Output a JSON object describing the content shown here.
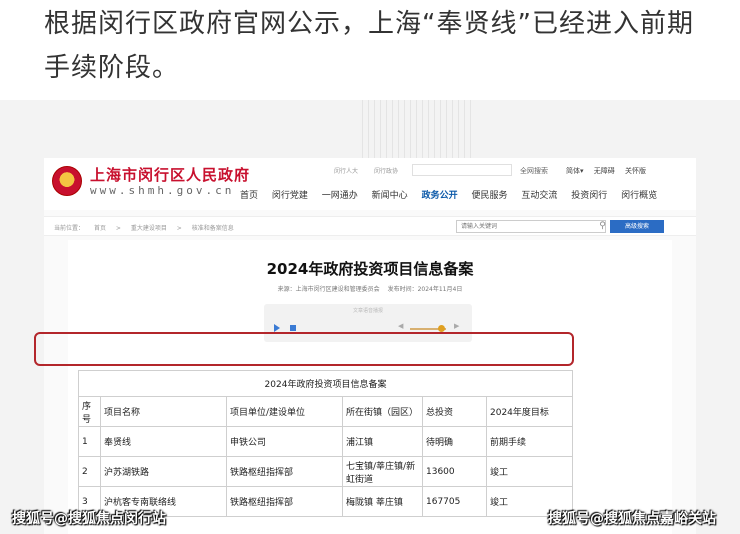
{
  "headline": {
    "line1": "根据闵行区政府官网公示，上海“奉贤线”已经进入前期",
    "line2": "手续阶段。"
  },
  "site": {
    "name": "上海市闵行区人民政府",
    "url": "www.shmh.gov.cn",
    "emblem_icon": "national-emblem-icon",
    "top_links": [
      "闵行人大",
      "闵行政协"
    ],
    "full_search": "全网搜索",
    "lang": [
      "简体▾",
      "无障碍",
      "关怀版"
    ],
    "nav": [
      "首页",
      "闵行党建",
      "一网通办",
      "新闻中心",
      "政务公开",
      "便民服务",
      "互动交流",
      "投资闵行",
      "闵行概览"
    ],
    "nav_active": "政务公开"
  },
  "breadcrumb": {
    "items": [
      "当前位置：",
      "首页",
      ">",
      "重大建设项目",
      ">",
      "核准和备案信息"
    ],
    "search_placeholder": "请输入关键词",
    "search_icon": "search-icon",
    "advanced_label": "高级搜索"
  },
  "document": {
    "title": "2024年政府投资项目信息备案",
    "source": "来源：上海市闵行区建设和管理委员会",
    "published": "发布时间：2024年11月4日",
    "player_label": "文章语音播报"
  },
  "table": {
    "caption": "2024年政府投资项目信息备案",
    "headers": [
      "序号",
      "项目名称",
      "项目单位/建设单位",
      "所在街镇（园区）",
      "总投资",
      "2024年度目标"
    ],
    "rows": [
      [
        "1",
        "奉贤线",
        "申铁公司",
        "浦江镇",
        "待明确",
        "前期手续"
      ],
      [
        "2",
        "沪苏湖铁路",
        "铁路枢纽指挥部",
        "七宝镇/莘庄镇/新虹街道",
        "13600",
        "竣工"
      ],
      [
        "3",
        "沪杭客专南联络线",
        "铁路枢纽指挥部",
        "梅陇镇 莘庄镇",
        "167705",
        "竣工"
      ]
    ]
  },
  "watermarks": {
    "left": "搜狐号@搜狐焦点闵行站",
    "right": "搜狐号@搜狐焦点嘉峪关站"
  },
  "colors": {
    "brand_red": "#c8102e",
    "nav_blue": "#0a58a8",
    "button_blue": "#2b6cc4",
    "highlight_red": "#b3262b"
  }
}
